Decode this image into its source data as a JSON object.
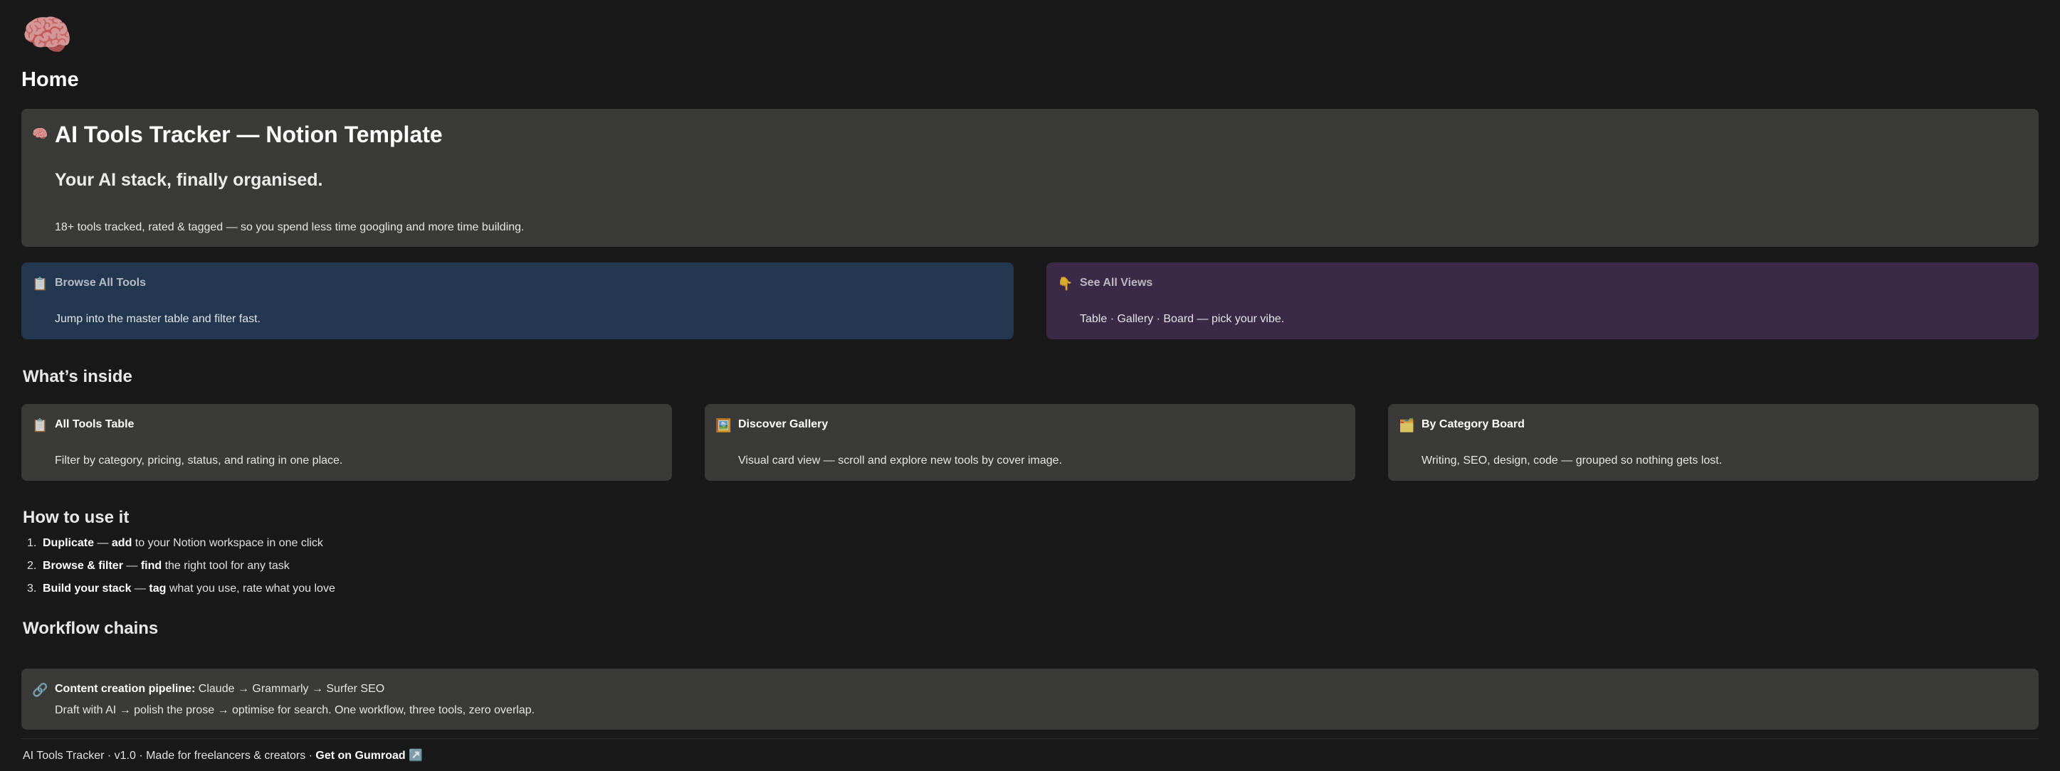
{
  "page": {
    "icon": "🧠",
    "icon_name": "brain-icon",
    "title": "Home"
  },
  "hero": {
    "icon": "🧠",
    "title": "AI Tools Tracker — Notion Template",
    "subtitle": "Your AI stack, finally organised.",
    "description": "18+ tools tracked, rated & tagged — so you spend less time googling and more time building."
  },
  "quick_links": [
    {
      "icon": "📋",
      "title": "Browse All Tools",
      "description": "Jump into the master table and filter fast.",
      "color": "#233750"
    },
    {
      "icon": "👇",
      "title": "See All Views",
      "description": "Table · Gallery · Board — pick your vibe.",
      "color": "#3b2a47"
    }
  ],
  "whats_inside": {
    "heading": "What’s inside",
    "cards": [
      {
        "icon": "📋",
        "title": "All Tools Table",
        "description": "Filter by category, pricing, status, and rating in one place."
      },
      {
        "icon": "🖼️",
        "title": "Discover Gallery",
        "description": "Visual card view — scroll and explore new tools by cover image."
      },
      {
        "icon": "🗂️",
        "title": "By Category Board",
        "description": "Writing, SEO, design, code — grouped so nothing gets lost."
      }
    ]
  },
  "how_to": {
    "heading": "How to use it",
    "steps": [
      {
        "num": "1.",
        "bold": "Duplicate",
        "sep": " — ",
        "verb": "add",
        "rest": " to your Notion workspace in one click"
      },
      {
        "num": "2.",
        "bold": "Browse & filter",
        "sep": " — ",
        "verb": "find",
        "rest": " the right tool for any task"
      },
      {
        "num": "3.",
        "bold": "Build your stack",
        "sep": " — ",
        "verb": "tag",
        "rest": " what you use, rate what you love"
      }
    ]
  },
  "workflow": {
    "heading": "Workflow chains",
    "icon": "🔗",
    "label": "Content creation pipeline:",
    "chain": " Claude → Grammarly → Surfer SEO",
    "description": "Draft with AI → polish the prose → optimise for search. One workflow, three tools, zero overlap."
  },
  "footer": {
    "text": "AI Tools Tracker · v1.0 · Made for freelancers & creators · ",
    "link": "Get on Gumroad",
    "link_icon": "↗️"
  },
  "colors": {
    "background": "#191919",
    "callout_gray": "#3a3a38",
    "callout_blue": "#233750",
    "callout_purple": "#3b2a47"
  }
}
